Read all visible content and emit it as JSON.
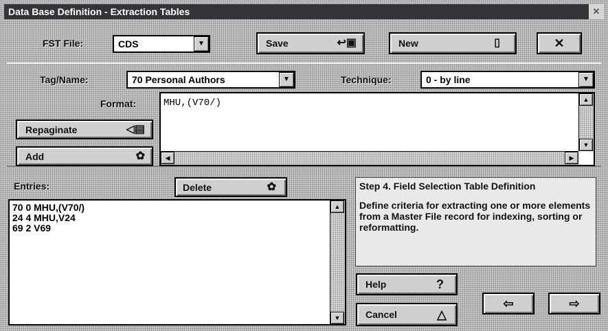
{
  "window": {
    "title": "Data Base Definition - Extraction Tables"
  },
  "top": {
    "fst_label": "FST File:",
    "fst_value": "CDS",
    "save_label": "Save",
    "new_label": "New"
  },
  "format_group": {
    "tag_label": "Tag/Name:",
    "tag_value": "70 Personal Authors",
    "technique_label": "Technique:",
    "technique_value": "0 - by line",
    "format_label": "Format:",
    "format_value": "MHU,(V70/)",
    "repaginate_label": "Repaginate",
    "add_label": "Add"
  },
  "entries": {
    "label": "Entries:",
    "delete_label": "Delete",
    "items": [
      "70 0 MHU,(V70/)",
      "24 4 MHU,V24",
      "69 2 V69"
    ]
  },
  "info": {
    "heading": "Step 4. Field Selection Table Definition",
    "body": "Define criteria for extracting one or more elements from a Master File record for indexing, sorting or reformatting."
  },
  "bottom": {
    "help_label": "Help",
    "cancel_label": "Cancel"
  },
  "icons": {
    "save": "floppy-disk-icon",
    "new": "new-page-icon",
    "close": "x-icon",
    "repaginate": "repaginate-icon",
    "add": "gear-icon",
    "delete": "gear-icon",
    "help": "question-mark-icon",
    "cancel": "warning-triangle-icon",
    "back": "left-arrow-icon",
    "next": "right-arrow-icon"
  }
}
